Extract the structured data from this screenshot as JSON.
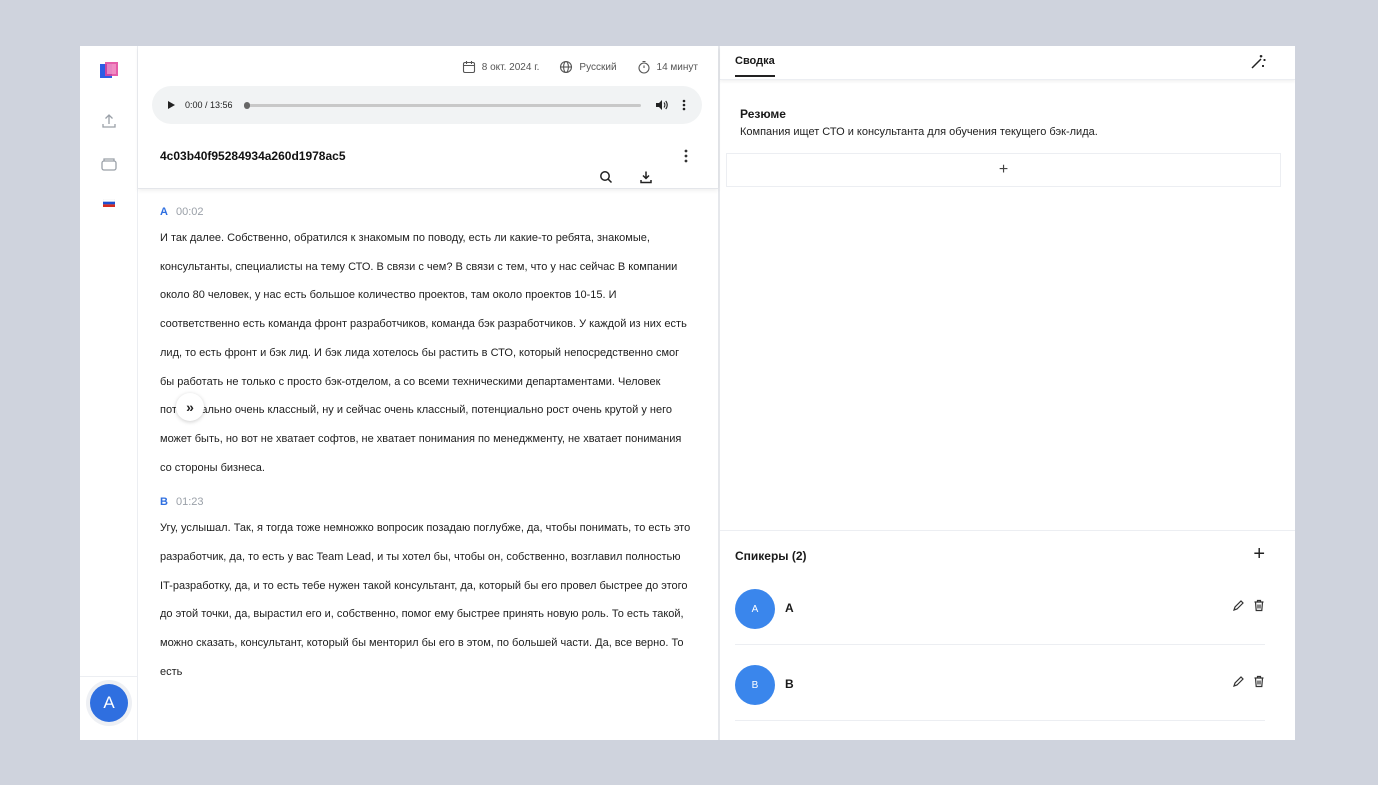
{
  "rail": {
    "avatar_letter": "A",
    "icons": [
      "app-logo-icon",
      "upload-icon",
      "folder-icon",
      "flag-ru-icon"
    ]
  },
  "transcript": {
    "meta": {
      "date": "8 окт. 2024 г.",
      "language": "Русский",
      "duration": "14 минут"
    },
    "player": {
      "time": "0:00 / 13:56",
      "progress": 0
    },
    "title": "4c03b40f95284934a260d1978ac5",
    "segments": [
      {
        "speaker": "A",
        "time": "00:02",
        "text": " И так далее.  Собственно, обратился к знакомым по поводу, есть ли какие-то ребята, знакомые, консультанты, специалисты на тему СТО.  В связи с чем?  В связи с тем, что у нас сейчас В компании около 80 человек, у нас есть большое количество проектов, там около проектов 10-15.  И соответственно есть команда фронт разработчиков, команда бэк разработчиков.  У каждой из них есть лид, то есть фронт и бэк лид.  И бэк лида хотелось бы растить в СТО, который непосредственно смог бы работать не только с просто бэк-отделом, а со всеми техническими департаментами.  Человек потенциально очень классный, ну и сейчас очень классный, потенциально рост очень крутой у него может быть, но вот не хватает софтов, не хватает понимания по менеджменту, не хватает понимания со стороны бизнеса."
      },
      {
        "speaker": "B",
        "time": "01:23",
        "text": " Угу, услышал.  Так, я тогда тоже немножко вопросик позадаю поглубже, да, чтобы понимать, то есть это разработчик, да, то есть у вас Team Lead, и ты хотел бы, чтобы он, собственно, возглавил полностью IT-разработку, да, и то есть тебе нужен такой консультант, да, который бы его провел быстрее до этого до этой точки, да, вырастил его и, собственно, помог ему быстрее принять новую роль.  То есть такой, можно сказать, консультант, который бы менторил бы его в этом, по большей части.  Да, все верно.  То есть"
      }
    ]
  },
  "summary": {
    "tab_label": "Сводка",
    "resume_title": "Резюме",
    "resume_text": "Компания ищет СТО и консультанта для обучения текущего бэк-лида.",
    "add_symbol": "+",
    "speakers_title": "Спикеры (2)",
    "speakers_add": "+",
    "speakers": [
      {
        "initial": "A",
        "name": "A"
      },
      {
        "initial": "B",
        "name": "B"
      }
    ]
  },
  "expand_symbol": "»",
  "colors": {
    "accent": "#2f6fe0",
    "speaker_avatar": "#3a86ec",
    "frame_bg": "#cfd3dd"
  }
}
